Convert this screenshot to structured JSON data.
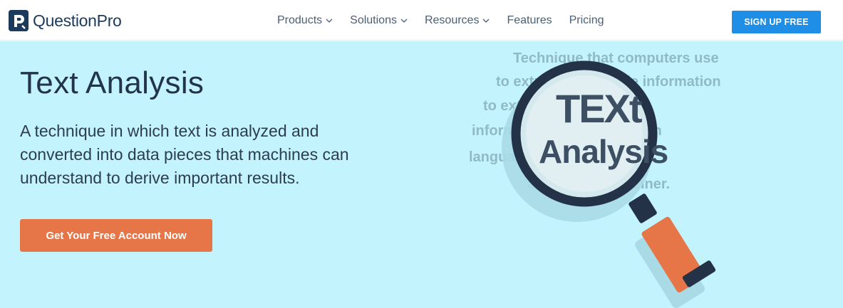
{
  "brand": {
    "name": "QuestionPro",
    "logo_icon": "questionpro-logo-icon"
  },
  "nav": {
    "items": [
      {
        "label": "Products",
        "has_dropdown": true
      },
      {
        "label": "Solutions",
        "has_dropdown": true
      },
      {
        "label": "Resources",
        "has_dropdown": true
      },
      {
        "label": "Features",
        "has_dropdown": false
      },
      {
        "label": "Pricing",
        "has_dropdown": false
      }
    ],
    "signup_label": "SIGN UP FREE"
  },
  "hero": {
    "title": "Text Analysis",
    "description": "A technique in which text is analyzed and converted into data pieces that machines can understand to derive important results.",
    "cta_label": "Get Your Free Account Now"
  },
  "illustration": {
    "background_lines": [
      "Technique that computers use",
      "to extract worthwhile information",
      "to extract worthwhile",
      "information from the human",
      "language in a smart",
      "and efficient manner."
    ],
    "magnified_word_1": "TEXt",
    "magnified_word_2": "Analysis"
  },
  "colors": {
    "brand_navy": "#1b3a5c",
    "signup_blue": "#1f8ee6",
    "hero_bg": "#c3f3fc",
    "cta_orange": "#e67648"
  }
}
